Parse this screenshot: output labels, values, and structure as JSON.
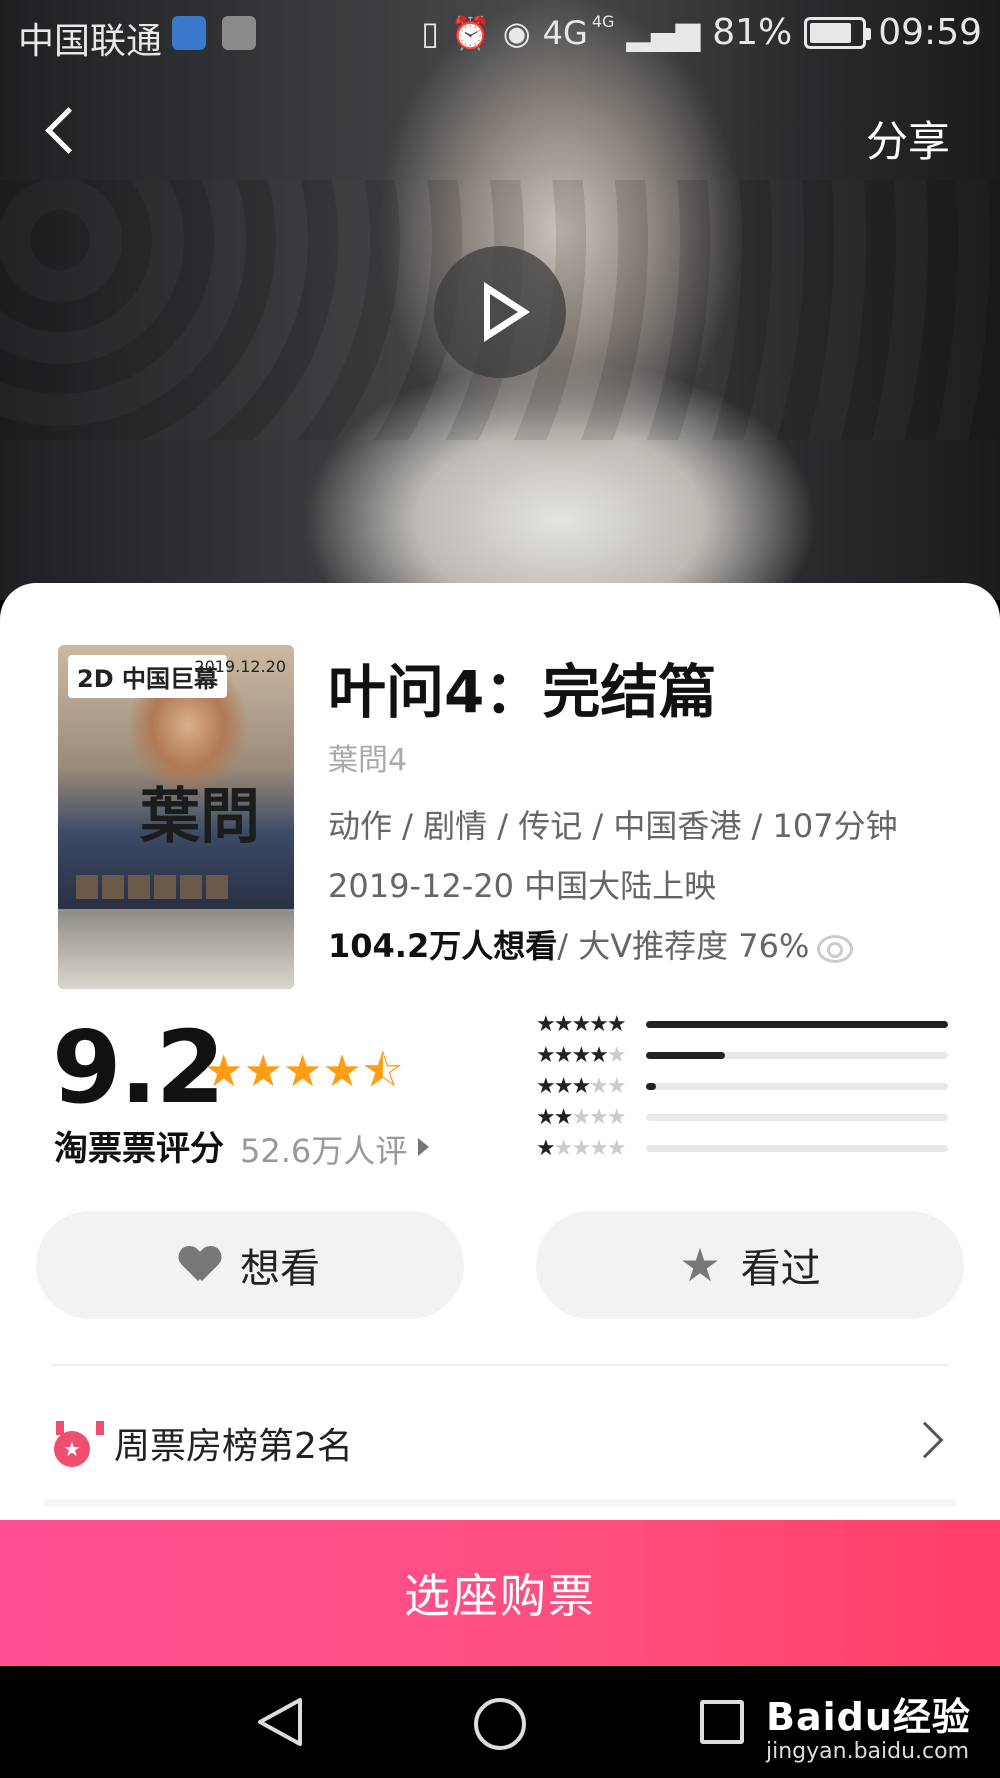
{
  "status_bar": {
    "carrier": "中国联通",
    "network": "4G",
    "network_small": "4G",
    "battery": "81%",
    "battery_level": 0.81,
    "time": "09:59"
  },
  "header": {
    "share_label": "分享"
  },
  "movie": {
    "poster_tag": "2D 中国巨幕",
    "poster_date": "2019.12.20",
    "poster_calligraphy": "葉問",
    "title": "叶问4：完结篇",
    "original_title": "葉問4",
    "genre_line": "动作 / 剧情 / 传记 / 中国香港 / 107分钟",
    "release_line": "2019-12-20 中国大陆上映",
    "want_count": "104.2万人想看",
    "recommend": " / 大V推荐度 76%"
  },
  "rating": {
    "score": "9.2",
    "stars_value": 4.5,
    "label": "淘票票评分",
    "count": "52.6万人评",
    "distribution": [
      {
        "stars": 5,
        "fraction": 1.0
      },
      {
        "stars": 4,
        "fraction": 0.26
      },
      {
        "stars": 3,
        "fraction": 0.03
      },
      {
        "stars": 2,
        "fraction": 0.0
      },
      {
        "stars": 1,
        "fraction": 0.0
      }
    ]
  },
  "actions": {
    "want_label": "想看",
    "seen_label": "看过"
  },
  "rank": {
    "label": "周票房榜第2名"
  },
  "buy": {
    "label": "选座购票"
  },
  "watermark": {
    "main": "Baidu经验",
    "sub": "jingyan.baidu.com"
  },
  "colors": {
    "accent": "#ff4f7e",
    "star": "#ff9d12",
    "medal": "#f04e6e"
  }
}
